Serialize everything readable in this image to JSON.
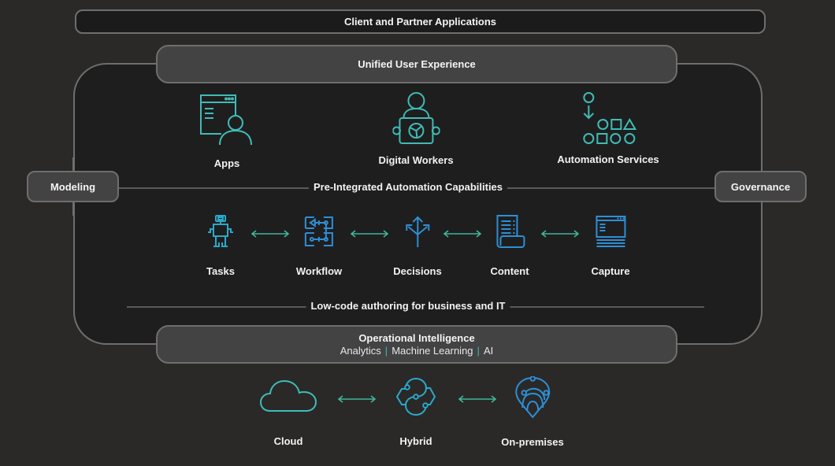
{
  "diagram": {
    "top_bar": "Client and Partner Applications",
    "unified_ux": "Unified User Experience",
    "side_left": "Modeling",
    "side_right": "Governance",
    "experience_nodes": [
      {
        "label": "Apps",
        "icon": "app-user-icon"
      },
      {
        "label": "Digital Workers",
        "icon": "digital-worker-icon"
      },
      {
        "label": "Automation Services",
        "icon": "automation-shapes-icon"
      }
    ],
    "capabilities_title": "Pre-Integrated Automation Capabilities",
    "capabilities": [
      {
        "label": "Tasks",
        "icon": "robot-icon"
      },
      {
        "label": "Workflow",
        "icon": "workflow-icon"
      },
      {
        "label": "Decisions",
        "icon": "decision-split-icon"
      },
      {
        "label": "Content",
        "icon": "document-scroll-icon"
      },
      {
        "label": "Capture",
        "icon": "capture-window-icon"
      }
    ],
    "authoring_title": "Low-code authoring for business and IT",
    "operational": {
      "title": "Operational Intelligence",
      "items": [
        "Analytics",
        "Machine Learning",
        "AI"
      ],
      "separator": "|"
    },
    "deployment": [
      {
        "label": "Cloud",
        "icon": "cloud-icon"
      },
      {
        "label": "Hybrid",
        "icon": "hybrid-icon"
      },
      {
        "label": "On-premises",
        "icon": "location-pin-icon"
      }
    ],
    "colors": {
      "teal": "#3fbcb5",
      "blue": "#2d8fd5",
      "arrow": "#3fb59a",
      "background": "#2a2928",
      "panel": "#1f1e1f",
      "pill": "#444344"
    }
  }
}
